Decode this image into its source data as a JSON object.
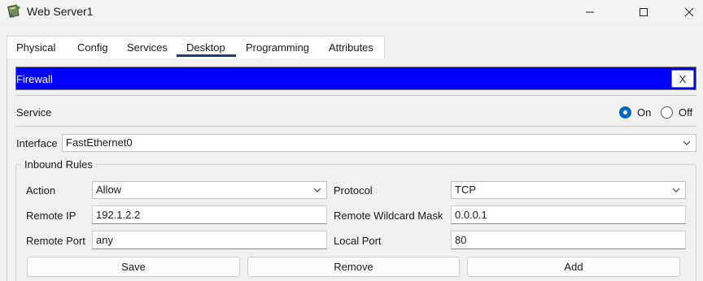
{
  "window": {
    "title": "Web Server1",
    "icon": "server-device-icon"
  },
  "tabs": [
    {
      "label": "Physical",
      "active": false
    },
    {
      "label": "Config",
      "active": false
    },
    {
      "label": "Services",
      "active": false
    },
    {
      "label": "Desktop",
      "active": true
    },
    {
      "label": "Programming",
      "active": false
    },
    {
      "label": "Attributes",
      "active": false
    }
  ],
  "firewall": {
    "title": "Firewall",
    "close_label": "X",
    "bar_color": "#0000ff"
  },
  "service": {
    "label": "Service",
    "on_label": "On",
    "off_label": "Off",
    "selected": "On"
  },
  "interface": {
    "label": "Interface",
    "value": "FastEthernet0"
  },
  "inbound": {
    "group_title": "Inbound Rules",
    "action_label": "Action",
    "action_value": "Allow",
    "protocol_label": "Protocol",
    "protocol_value": "TCP",
    "remote_ip_label": "Remote IP",
    "remote_ip_value": "192.1.2.2",
    "remote_wildcard_label": "Remote Wildcard Mask",
    "remote_wildcard_value": "0.0.0.1",
    "remote_port_label": "Remote Port",
    "remote_port_value": "any",
    "local_port_label": "Local Port",
    "local_port_value": "80"
  },
  "buttons": {
    "save": "Save",
    "remove": "Remove",
    "add": "Add"
  }
}
